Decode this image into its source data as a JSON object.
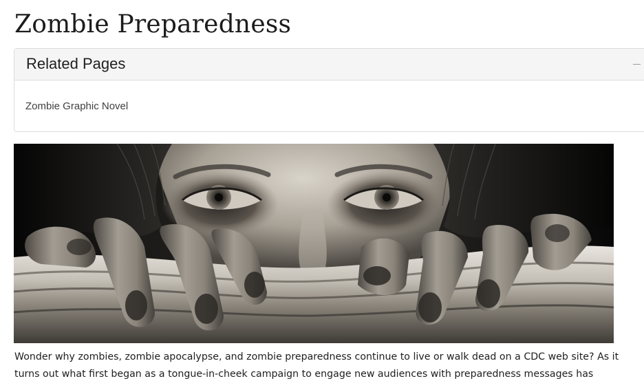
{
  "page": {
    "title": "Zombie Preparedness"
  },
  "related_pages": {
    "heading": "Related Pages",
    "collapse_symbol": "–",
    "links": [
      {
        "label": "Zombie Graphic Novel"
      }
    ]
  },
  "hero": {
    "description": "Black and white photo of a pale zombie woman peering over a cloth she grips with grimy fingers"
  },
  "intro": {
    "lines": [
      "Wonder why zombies, zombie apocalypse, and zombie preparedness continue to live or walk dead on a CDC web site? As it",
      "turns out what first began as a tongue-in-cheek campaign to engage new audiences with preparedness messages has"
    ]
  },
  "colors": {
    "heading_bg": "#f5f5f5",
    "border": "#dcdcdc",
    "link": "#404040",
    "text": "#1e1e1e"
  }
}
